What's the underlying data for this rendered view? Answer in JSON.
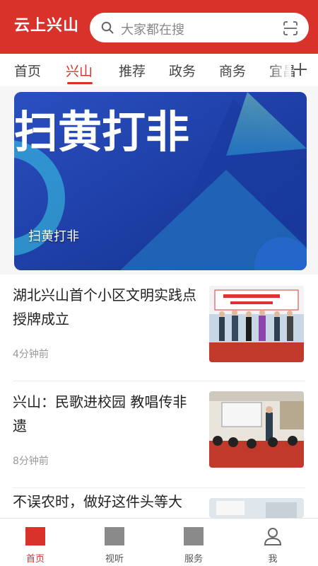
{
  "app": {
    "title": "云上兴山"
  },
  "search": {
    "placeholder": "大家都在搜"
  },
  "tabs": [
    {
      "label": "首页",
      "active": false
    },
    {
      "label": "兴山",
      "active": true
    },
    {
      "label": "推荐",
      "active": false
    },
    {
      "label": "政务",
      "active": false
    },
    {
      "label": "商务",
      "active": false
    },
    {
      "label": "宜昌",
      "active": false
    }
  ],
  "banner": {
    "title": "扫黄打非",
    "caption": "扫黄打非"
  },
  "news": [
    {
      "title": "湖北兴山首个小区文明实践点授牌成立",
      "time": "4分钟前",
      "thumb": "ceremony-photo"
    },
    {
      "title": "兴山：民歌进校园 教唱传非遗",
      "time": "8分钟前",
      "thumb": "classroom-photo"
    },
    {
      "title": "不误农时，做好这件头等大",
      "time": "",
      "thumb": "classroom-photo-2"
    }
  ],
  "bottom_nav": [
    {
      "label": "首页",
      "icon": "home-icon",
      "active": true
    },
    {
      "label": "视听",
      "icon": "video-icon",
      "active": false
    },
    {
      "label": "服务",
      "icon": "service-icon",
      "active": false
    },
    {
      "label": "我",
      "icon": "user-icon",
      "active": false
    }
  ],
  "colors": {
    "brand": "#d8322a",
    "banner_blue": "#1a3fa8",
    "banner_cyan": "#35c7ee"
  }
}
